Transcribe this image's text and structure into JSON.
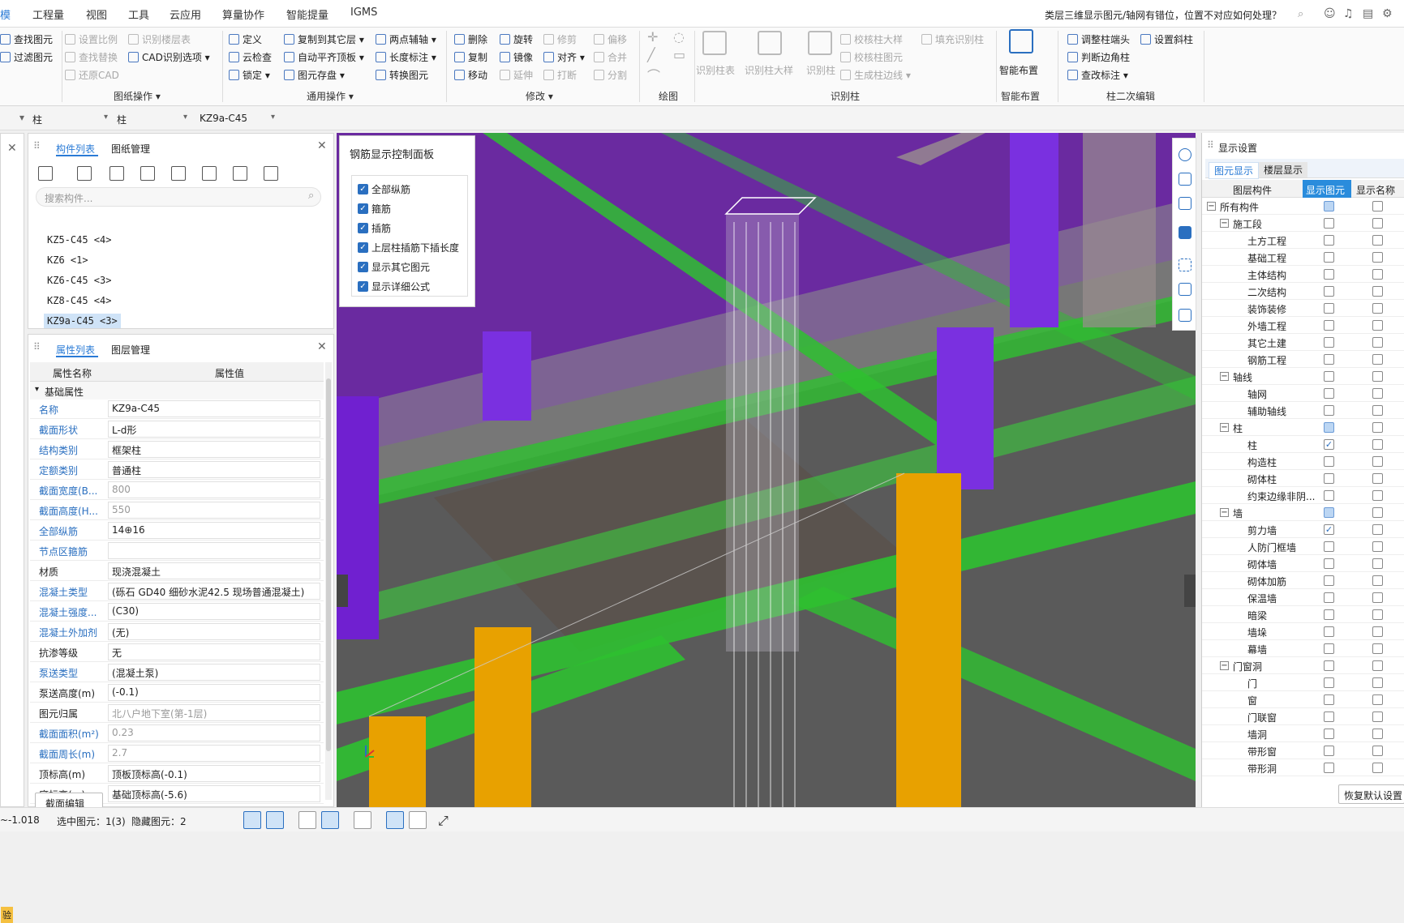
{
  "menu": {
    "items": [
      "模",
      "工程量",
      "视图",
      "工具",
      "云应用",
      "算量协作",
      "智能提量",
      "IGMS"
    ],
    "help_text": "类层三维显示图元/轴网有错位，位置不对应如何处理？"
  },
  "ribbon": {
    "groups": {
      "g1": {
        "items": [
          "查找图元",
          "过滤图元"
        ]
      },
      "drawing": {
        "label": "图纸操作 ▾",
        "items": [
          "设置比例",
          "识别楼层表",
          "查找替换",
          "CAD识别选项 ▾",
          "还原CAD"
        ]
      },
      "common": {
        "label": "通用操作 ▾",
        "items": [
          "定义",
          "复制到其它层 ▾",
          "两点辅轴 ▾",
          "云检查",
          "自动平齐顶板 ▾",
          "长度标注 ▾",
          "锁定 ▾",
          "图元存盘 ▾",
          "转换图元"
        ]
      },
      "modify": {
        "label": "修改 ▾",
        "items": [
          "删除",
          "旋转",
          "修剪",
          "偏移",
          "复制",
          "镜像",
          "对齐 ▾",
          "合并",
          "移动",
          "延伸",
          "打断",
          "分割"
        ]
      },
      "draw": {
        "label": "绘图"
      },
      "identify": {
        "label": "识别柱",
        "items": [
          "识别柱表",
          "识别柱大样",
          "识别柱",
          "校核柱大样",
          "填充识别柱",
          "校核柱图元",
          "生成柱边线 ▾"
        ]
      },
      "smart": {
        "label": "智能布置",
        "items": [
          "智能布置"
        ]
      },
      "col2": {
        "label": "柱二次编辑",
        "items": [
          "调整柱端头",
          "设置斜柱",
          "判断边角柱",
          "查改标注 ▾"
        ]
      }
    }
  },
  "selector": {
    "floor": "柱",
    "type": "柱",
    "component": "KZ9a-C45"
  },
  "component_panel": {
    "tabs": [
      "构件列表",
      "图纸管理"
    ],
    "search_placeholder": "搜索构件...",
    "items": [
      "KZ5-C45 <4>",
      "KZ6 <1>",
      "KZ6-C45 <3>",
      "KZ8-C45 <4>",
      "KZ9a-C45 <3>"
    ]
  },
  "property_panel": {
    "tabs": [
      "属性列表",
      "图层管理"
    ],
    "headers": [
      "属性名称",
      "属性值"
    ],
    "section": "基础属性",
    "rows": [
      {
        "name": "名称",
        "value": "KZ9a-C45",
        "blue": true,
        "gray": false
      },
      {
        "name": "截面形状",
        "value": "L-d形",
        "blue": true,
        "gray": false
      },
      {
        "name": "结构类别",
        "value": "框架柱",
        "blue": true,
        "gray": false
      },
      {
        "name": "定额类别",
        "value": "普通柱",
        "blue": true,
        "gray": false
      },
      {
        "name": "截面宽度(B...",
        "value": "800",
        "blue": true,
        "gray": true
      },
      {
        "name": "截面高度(H...",
        "value": "550",
        "blue": true,
        "gray": true
      },
      {
        "name": "全部纵筋",
        "value": "14⊕16",
        "blue": true,
        "gray": false
      },
      {
        "name": "节点区箍筋",
        "value": "",
        "blue": true,
        "gray": false
      },
      {
        "name": "材质",
        "value": "现浇混凝土",
        "blue": false,
        "gray": false
      },
      {
        "name": "混凝土类型",
        "value": "(砾石 GD40 细砂水泥42.5  现场普通混凝土)",
        "blue": true,
        "gray": false
      },
      {
        "name": "混凝土强度...",
        "value": "(C30)",
        "blue": true,
        "gray": false
      },
      {
        "name": "混凝土外加剂",
        "value": "(无)",
        "blue": true,
        "gray": false
      },
      {
        "name": "抗渗等级",
        "value": "无",
        "blue": false,
        "gray": false
      },
      {
        "name": "泵送类型",
        "value": "(混凝土泵)",
        "blue": true,
        "gray": false
      },
      {
        "name": "泵送高度(m)",
        "value": "(-0.1)",
        "blue": false,
        "gray": false
      },
      {
        "name": "图元归属",
        "value": "北八户地下室(第-1层)",
        "blue": false,
        "gray": true
      },
      {
        "name": "截面面积(m²)",
        "value": "0.23",
        "blue": true,
        "gray": true
      },
      {
        "name": "截面周长(m)",
        "value": "2.7",
        "blue": true,
        "gray": true
      },
      {
        "name": "顶标高(m)",
        "value": "顶板顶标高(-0.1)",
        "blue": false,
        "gray": false
      },
      {
        "name": "底标高(m)",
        "value": "基础顶标高(-5.6)",
        "blue": false,
        "gray": false
      }
    ],
    "edit_button": "截面编辑"
  },
  "rebar_panel": {
    "title": "钢筋显示控制面板",
    "options": [
      "全部纵筋",
      "箍筋",
      "插筋",
      "上层柱插筋下插长度",
      "显示其它图元",
      "显示详细公式"
    ]
  },
  "display_panel": {
    "title": "显示设置",
    "tabs": [
      "图元显示",
      "楼层显示"
    ],
    "headers": [
      "图层构件",
      "显示图元",
      "显示名称"
    ],
    "rows": [
      {
        "label": "所有构件",
        "level": 0,
        "exp": "−",
        "s": "p",
        "n": "0"
      },
      {
        "label": "施工段",
        "level": 1,
        "exp": "−",
        "s": "0",
        "n": "0"
      },
      {
        "label": "土方工程",
        "level": 2,
        "exp": "",
        "s": "0",
        "n": "0"
      },
      {
        "label": "基础工程",
        "level": 2,
        "exp": "",
        "s": "0",
        "n": "0"
      },
      {
        "label": "主体结构",
        "level": 2,
        "exp": "",
        "s": "0",
        "n": "0"
      },
      {
        "label": "二次结构",
        "level": 2,
        "exp": "",
        "s": "0",
        "n": "0"
      },
      {
        "label": "装饰装修",
        "level": 2,
        "exp": "",
        "s": "0",
        "n": "0"
      },
      {
        "label": "外墙工程",
        "level": 2,
        "exp": "",
        "s": "0",
        "n": "0"
      },
      {
        "label": "其它土建",
        "level": 2,
        "exp": "",
        "s": "0",
        "n": "0"
      },
      {
        "label": "钢筋工程",
        "level": 2,
        "exp": "",
        "s": "0",
        "n": "0"
      },
      {
        "label": "轴线",
        "level": 1,
        "exp": "−",
        "s": "0",
        "n": "0"
      },
      {
        "label": "轴网",
        "level": 2,
        "exp": "",
        "s": "0",
        "n": "0"
      },
      {
        "label": "辅助轴线",
        "level": 2,
        "exp": "",
        "s": "0",
        "n": "0"
      },
      {
        "label": "柱",
        "level": 1,
        "exp": "−",
        "s": "p",
        "n": "0"
      },
      {
        "label": "柱",
        "level": 2,
        "exp": "",
        "s": "1",
        "n": "0"
      },
      {
        "label": "构造柱",
        "level": 2,
        "exp": "",
        "s": "0",
        "n": "0"
      },
      {
        "label": "砌体柱",
        "level": 2,
        "exp": "",
        "s": "0",
        "n": "0"
      },
      {
        "label": "约束边缘非阴...",
        "level": 2,
        "exp": "",
        "s": "0",
        "n": "0"
      },
      {
        "label": "墙",
        "level": 1,
        "exp": "−",
        "s": "p",
        "n": "0"
      },
      {
        "label": "剪力墙",
        "level": 2,
        "exp": "",
        "s": "1",
        "n": "0"
      },
      {
        "label": "人防门框墙",
        "level": 2,
        "exp": "",
        "s": "0",
        "n": "0"
      },
      {
        "label": "砌体墙",
        "level": 2,
        "exp": "",
        "s": "0",
        "n": "0"
      },
      {
        "label": "砌体加筋",
        "level": 2,
        "exp": "",
        "s": "0",
        "n": "0"
      },
      {
        "label": "保温墙",
        "level": 2,
        "exp": "",
        "s": "0",
        "n": "0"
      },
      {
        "label": "暗梁",
        "level": 2,
        "exp": "",
        "s": "0",
        "n": "0"
      },
      {
        "label": "墙垛",
        "level": 2,
        "exp": "",
        "s": "0",
        "n": "0"
      },
      {
        "label": "幕墙",
        "level": 2,
        "exp": "",
        "s": "0",
        "n": "0"
      },
      {
        "label": "门窗洞",
        "level": 1,
        "exp": "−",
        "s": "0",
        "n": "0"
      },
      {
        "label": "门",
        "level": 2,
        "exp": "",
        "s": "0",
        "n": "0"
      },
      {
        "label": "窗",
        "level": 2,
        "exp": "",
        "s": "0",
        "n": "0"
      },
      {
        "label": "门联窗",
        "level": 2,
        "exp": "",
        "s": "0",
        "n": "0"
      },
      {
        "label": "墙洞",
        "level": 2,
        "exp": "",
        "s": "0",
        "n": "0"
      },
      {
        "label": "带形窗",
        "level": 2,
        "exp": "",
        "s": "0",
        "n": "0"
      },
      {
        "label": "带形洞",
        "level": 2,
        "exp": "",
        "s": "0",
        "n": "0"
      }
    ],
    "restore_button": "恢复默认设置"
  },
  "status": {
    "coord": "~-1.018",
    "selected": "选中图元：1(3)",
    "hidden": "隐藏图元：2"
  },
  "side_tag": "验",
  "colors": {
    "accent": "#2a7bd6",
    "purple": "#6a2aa0",
    "green": "#2ec030",
    "orange": "#e8a100"
  }
}
